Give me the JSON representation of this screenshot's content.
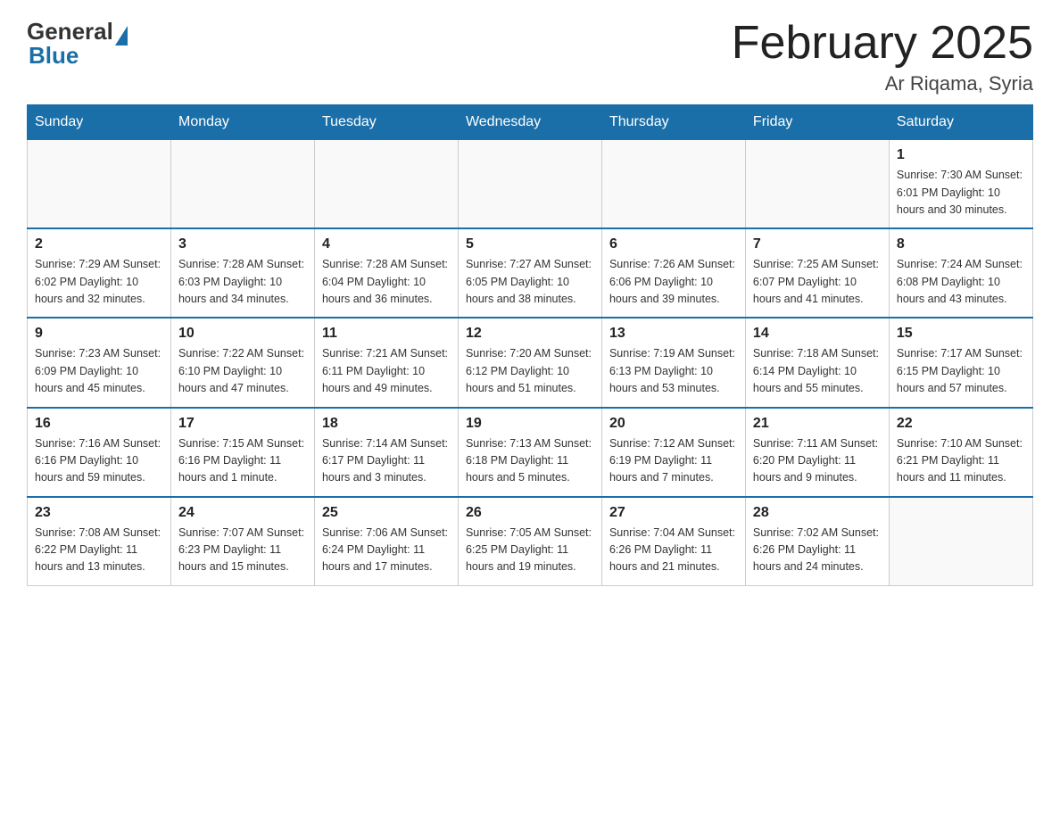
{
  "header": {
    "logo_general": "General",
    "logo_blue": "Blue",
    "title": "February 2025",
    "subtitle": "Ar Riqama, Syria"
  },
  "days_of_week": [
    "Sunday",
    "Monday",
    "Tuesday",
    "Wednesday",
    "Thursday",
    "Friday",
    "Saturday"
  ],
  "weeks": [
    [
      {
        "day": "",
        "info": ""
      },
      {
        "day": "",
        "info": ""
      },
      {
        "day": "",
        "info": ""
      },
      {
        "day": "",
        "info": ""
      },
      {
        "day": "",
        "info": ""
      },
      {
        "day": "",
        "info": ""
      },
      {
        "day": "1",
        "info": "Sunrise: 7:30 AM\nSunset: 6:01 PM\nDaylight: 10 hours\nand 30 minutes."
      }
    ],
    [
      {
        "day": "2",
        "info": "Sunrise: 7:29 AM\nSunset: 6:02 PM\nDaylight: 10 hours\nand 32 minutes."
      },
      {
        "day": "3",
        "info": "Sunrise: 7:28 AM\nSunset: 6:03 PM\nDaylight: 10 hours\nand 34 minutes."
      },
      {
        "day": "4",
        "info": "Sunrise: 7:28 AM\nSunset: 6:04 PM\nDaylight: 10 hours\nand 36 minutes."
      },
      {
        "day": "5",
        "info": "Sunrise: 7:27 AM\nSunset: 6:05 PM\nDaylight: 10 hours\nand 38 minutes."
      },
      {
        "day": "6",
        "info": "Sunrise: 7:26 AM\nSunset: 6:06 PM\nDaylight: 10 hours\nand 39 minutes."
      },
      {
        "day": "7",
        "info": "Sunrise: 7:25 AM\nSunset: 6:07 PM\nDaylight: 10 hours\nand 41 minutes."
      },
      {
        "day": "8",
        "info": "Sunrise: 7:24 AM\nSunset: 6:08 PM\nDaylight: 10 hours\nand 43 minutes."
      }
    ],
    [
      {
        "day": "9",
        "info": "Sunrise: 7:23 AM\nSunset: 6:09 PM\nDaylight: 10 hours\nand 45 minutes."
      },
      {
        "day": "10",
        "info": "Sunrise: 7:22 AM\nSunset: 6:10 PM\nDaylight: 10 hours\nand 47 minutes."
      },
      {
        "day": "11",
        "info": "Sunrise: 7:21 AM\nSunset: 6:11 PM\nDaylight: 10 hours\nand 49 minutes."
      },
      {
        "day": "12",
        "info": "Sunrise: 7:20 AM\nSunset: 6:12 PM\nDaylight: 10 hours\nand 51 minutes."
      },
      {
        "day": "13",
        "info": "Sunrise: 7:19 AM\nSunset: 6:13 PM\nDaylight: 10 hours\nand 53 minutes."
      },
      {
        "day": "14",
        "info": "Sunrise: 7:18 AM\nSunset: 6:14 PM\nDaylight: 10 hours\nand 55 minutes."
      },
      {
        "day": "15",
        "info": "Sunrise: 7:17 AM\nSunset: 6:15 PM\nDaylight: 10 hours\nand 57 minutes."
      }
    ],
    [
      {
        "day": "16",
        "info": "Sunrise: 7:16 AM\nSunset: 6:16 PM\nDaylight: 10 hours\nand 59 minutes."
      },
      {
        "day": "17",
        "info": "Sunrise: 7:15 AM\nSunset: 6:16 PM\nDaylight: 11 hours\nand 1 minute."
      },
      {
        "day": "18",
        "info": "Sunrise: 7:14 AM\nSunset: 6:17 PM\nDaylight: 11 hours\nand 3 minutes."
      },
      {
        "day": "19",
        "info": "Sunrise: 7:13 AM\nSunset: 6:18 PM\nDaylight: 11 hours\nand 5 minutes."
      },
      {
        "day": "20",
        "info": "Sunrise: 7:12 AM\nSunset: 6:19 PM\nDaylight: 11 hours\nand 7 minutes."
      },
      {
        "day": "21",
        "info": "Sunrise: 7:11 AM\nSunset: 6:20 PM\nDaylight: 11 hours\nand 9 minutes."
      },
      {
        "day": "22",
        "info": "Sunrise: 7:10 AM\nSunset: 6:21 PM\nDaylight: 11 hours\nand 11 minutes."
      }
    ],
    [
      {
        "day": "23",
        "info": "Sunrise: 7:08 AM\nSunset: 6:22 PM\nDaylight: 11 hours\nand 13 minutes."
      },
      {
        "day": "24",
        "info": "Sunrise: 7:07 AM\nSunset: 6:23 PM\nDaylight: 11 hours\nand 15 minutes."
      },
      {
        "day": "25",
        "info": "Sunrise: 7:06 AM\nSunset: 6:24 PM\nDaylight: 11 hours\nand 17 minutes."
      },
      {
        "day": "26",
        "info": "Sunrise: 7:05 AM\nSunset: 6:25 PM\nDaylight: 11 hours\nand 19 minutes."
      },
      {
        "day": "27",
        "info": "Sunrise: 7:04 AM\nSunset: 6:26 PM\nDaylight: 11 hours\nand 21 minutes."
      },
      {
        "day": "28",
        "info": "Sunrise: 7:02 AM\nSunset: 6:26 PM\nDaylight: 11 hours\nand 24 minutes."
      },
      {
        "day": "",
        "info": ""
      }
    ]
  ]
}
